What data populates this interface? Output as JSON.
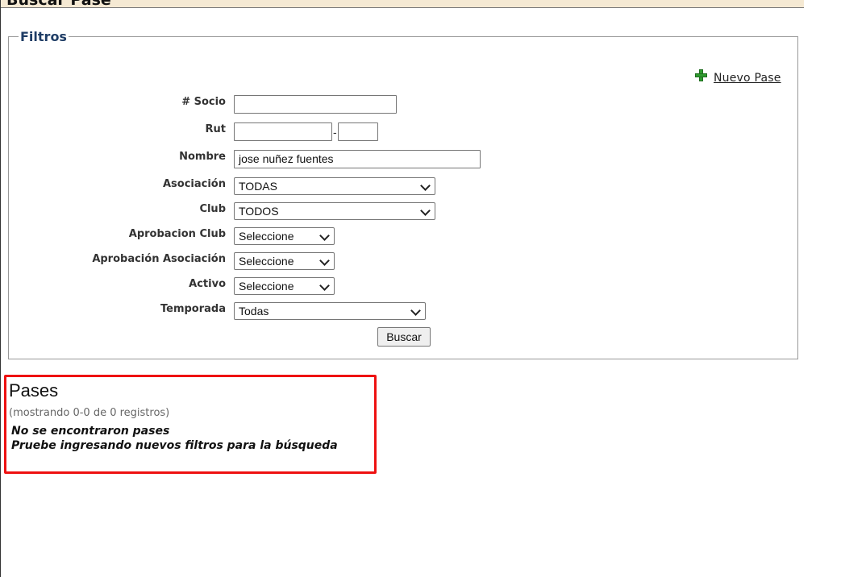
{
  "page": {
    "title": "Buscar Pase"
  },
  "filters": {
    "legend": "Filtros",
    "new_link": "Nuevo Pase",
    "fields": {
      "socio": {
        "label": "# Socio",
        "value": ""
      },
      "rut": {
        "label": "Rut",
        "value": "",
        "dv": "",
        "separator": "-"
      },
      "nombre": {
        "label": "Nombre",
        "value": "jose nuñez fuentes"
      },
      "asociacion": {
        "label": "Asociación",
        "value": "TODAS"
      },
      "club": {
        "label": "Club",
        "value": "TODOS"
      },
      "aprobacion_club": {
        "label": "Aprobacion Club",
        "value": "Seleccione"
      },
      "aprobacion_asociacion": {
        "label": "Aprobación Asociación",
        "value": "Seleccione"
      },
      "activo": {
        "label": "Activo",
        "value": "Seleccione"
      },
      "temporada": {
        "label": "Temporada",
        "value": "Todas"
      }
    },
    "search_button": "Buscar"
  },
  "results": {
    "title": "Pases",
    "count": "(mostrando 0-0 de 0 registros)",
    "empty_line1": "No se encontraron pases",
    "empty_line2": "Pruebe ingresando nuevos filtros para la búsqueda"
  },
  "colors": {
    "header_bg": "#f5e9d3",
    "legend": "#1f3d66",
    "highlight": "#ee1111",
    "plus": "#2f9a2f"
  }
}
